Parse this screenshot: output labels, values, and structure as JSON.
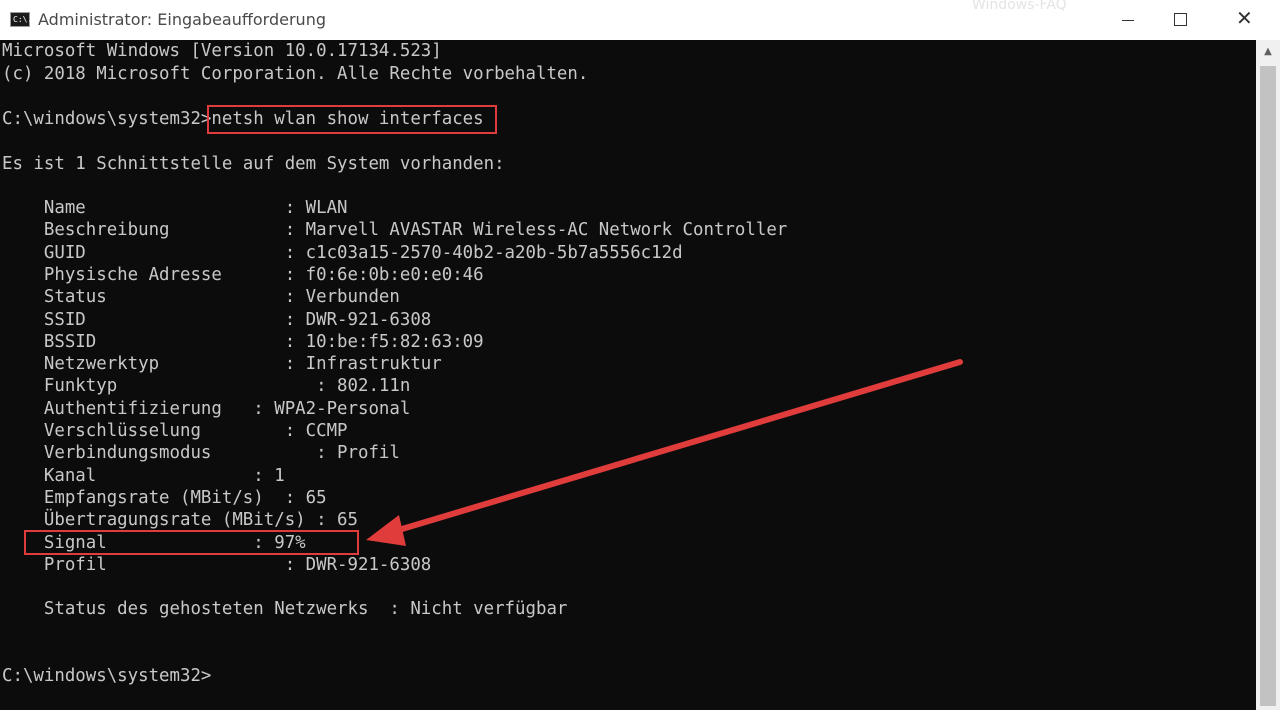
{
  "window": {
    "title": "Administrator: Eingabeaufforderung",
    "icon_label": "C:\\.",
    "icon_name": "cmd-icon",
    "watermark": "Windows-FAQ"
  },
  "controls": {
    "minimize": "minimize-icon",
    "maximize": "maximize-icon",
    "close": "✕"
  },
  "console": {
    "lines": [
      "Microsoft Windows [Version 10.0.17134.523]",
      "(c) 2018 Microsoft Corporation. Alle Rechte vorbehalten.",
      "",
      "C:\\windows\\system32>netsh wlan show interfaces",
      "",
      "Es ist 1 Schnittstelle auf dem System vorhanden:",
      "",
      "    Name                   : WLAN",
      "    Beschreibung           : Marvell AVASTAR Wireless-AC Network Controller",
      "    GUID                   : c1c03a15-2570-40b2-a20b-5b7a5556c12d",
      "    Physische Adresse      : f0:6e:0b:e0:e0:46",
      "    Status                 : Verbunden",
      "    SSID                   : DWR-921-6308",
      "    BSSID                  : 10:be:f5:82:63:09",
      "    Netzwerktyp            : Infrastruktur",
      "    Funktyp                   : 802.11n",
      "    Authentifizierung   : WPA2-Personal",
      "    Verschlüsselung        : CCMP",
      "    Verbindungsmodus          : Profil",
      "    Kanal               : 1",
      "    Empfangsrate (MBit/s)  : 65",
      "    Übertragungsrate (MBit/s) : 65",
      "    Signal              : 97%",
      "    Profil                 : DWR-921-6308",
      "",
      "    Status des gehosteten Netzwerks  : Nicht verfügbar",
      "",
      "",
      "C:\\windows\\system32>"
    ]
  },
  "colors": {
    "console_bg": "#0c0c0c",
    "console_text": "#c8c8c8",
    "highlight": "#e03c3c"
  }
}
